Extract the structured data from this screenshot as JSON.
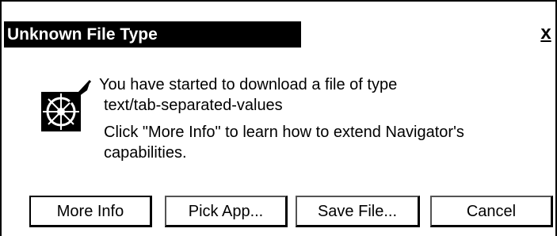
{
  "dialog": {
    "title": "Unknown File Type",
    "close_label": "x",
    "icon": "navigator-wheel-icon",
    "message_line1": "You have started to download a file of type",
    "message_line2": "text/tab-separated-values",
    "message_line3": "Click \"More Info\" to learn how to extend Navigator's",
    "message_line4": "capabilities."
  },
  "buttons": {
    "more_info": "More Info",
    "pick_app": "Pick App...",
    "save_file": "Save File...",
    "cancel": "Cancel"
  }
}
